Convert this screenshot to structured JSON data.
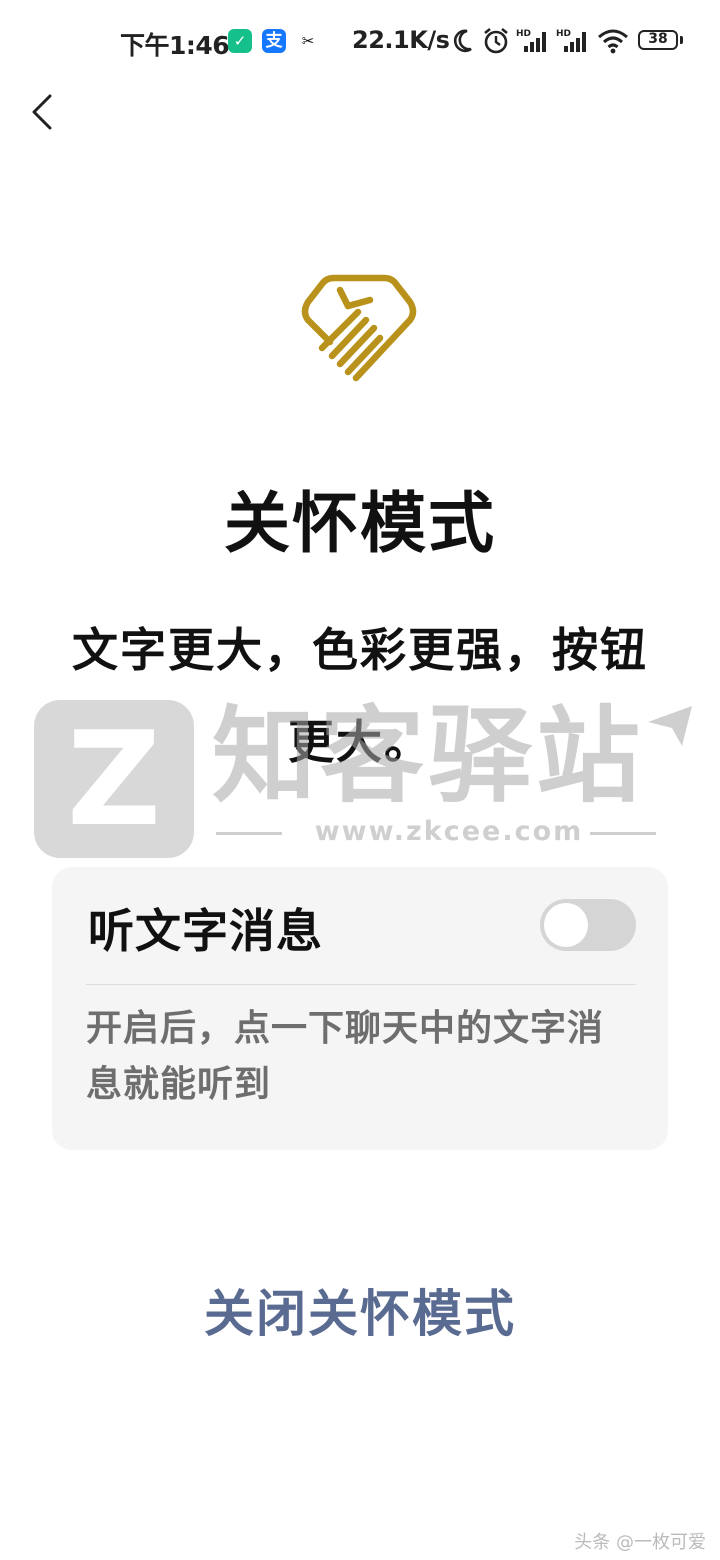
{
  "status_bar": {
    "time": "下午1:46",
    "network_speed": "22.1K/s",
    "battery": "38",
    "app_icons": [
      "shield-icon",
      "alipay-icon",
      "capcut-icon"
    ],
    "system_icons": [
      "moon-icon",
      "alarm-icon",
      "signal-hd-icon",
      "signal-hd-icon",
      "wifi-icon"
    ]
  },
  "header": {
    "back_icon": "chevron-left-icon"
  },
  "hero": {
    "icon": "care-heart-icon",
    "icon_color": "#b8921a",
    "title": "关怀模式",
    "subtitle": "文字更大，色彩更强，按钮更大。"
  },
  "watermark": {
    "logo_letter": "Z",
    "title": "知客驿站",
    "url": "www.zkcee.com"
  },
  "setting": {
    "label": "听文字消息",
    "toggle_on": false,
    "description": "开启后，点一下聊天中的文字消息就能听到"
  },
  "actions": {
    "close_label": "关闭关怀模式",
    "close_color": "#5a6b92"
  },
  "credit": "头条 @一枚可爱"
}
